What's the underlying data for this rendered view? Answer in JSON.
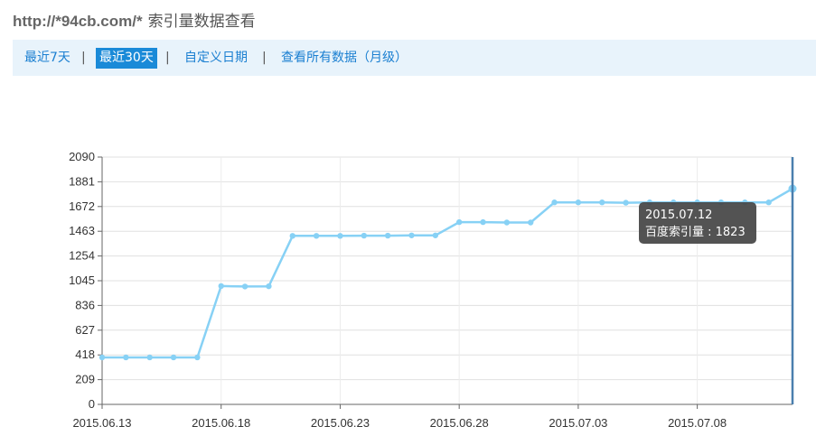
{
  "header": {
    "url": "http://*94cb.com/*",
    "label": "索引量数据查看"
  },
  "nav": {
    "items": [
      {
        "label": "最近7天",
        "active": false
      },
      {
        "label": "最近30天",
        "active": true
      },
      {
        "label": "自定义日期",
        "active": false
      },
      {
        "label": "查看所有数据（月级）",
        "active": false
      }
    ],
    "separator": "|"
  },
  "colors": {
    "line": "#87d1f5",
    "grid": "#e0e0e0",
    "cursor": "#4a7fae",
    "tooltip_bg": "#444444",
    "nav_bg": "#e8f3fb",
    "nav_active": "#1a8ad8"
  },
  "chart_data": {
    "type": "line",
    "series": [
      {
        "name": "百度索引量",
        "values": [
          397,
          397,
          397,
          397,
          397,
          1000,
          996,
          998,
          1424,
          1424,
          1424,
          1426,
          1426,
          1428,
          1428,
          1540,
          1540,
          1537,
          1537,
          1707,
          1707,
          1707,
          1704,
          1707,
          1707,
          1707,
          1707,
          1707,
          1707,
          1823
        ]
      }
    ],
    "x": [
      "2015.06.13",
      "2015.06.14",
      "2015.06.15",
      "2015.06.16",
      "2015.06.17",
      "2015.06.18",
      "2015.06.19",
      "2015.06.20",
      "2015.06.21",
      "2015.06.22",
      "2015.06.23",
      "2015.06.24",
      "2015.06.25",
      "2015.06.26",
      "2015.06.27",
      "2015.06.28",
      "2015.06.29",
      "2015.06.30",
      "2015.07.01",
      "2015.07.02",
      "2015.07.03",
      "2015.07.04",
      "2015.07.05",
      "2015.07.06",
      "2015.07.07",
      "2015.07.08",
      "2015.07.09",
      "2015.07.10",
      "2015.07.11",
      "2015.07.12"
    ],
    "x_tick_labels": [
      "2015.06.13",
      "2015.06.18",
      "2015.06.23",
      "2015.06.28",
      "2015.07.03",
      "2015.07.08"
    ],
    "y_ticks": [
      0,
      209,
      418,
      627,
      836,
      1045,
      1254,
      1463,
      1672,
      1881,
      2090
    ],
    "ylim": [
      0,
      2090
    ],
    "title": "",
    "xlabel": "",
    "ylabel": "",
    "grid": true,
    "tooltip": {
      "date": "2015.07.12",
      "text": "百度索引量 : 1823"
    }
  }
}
